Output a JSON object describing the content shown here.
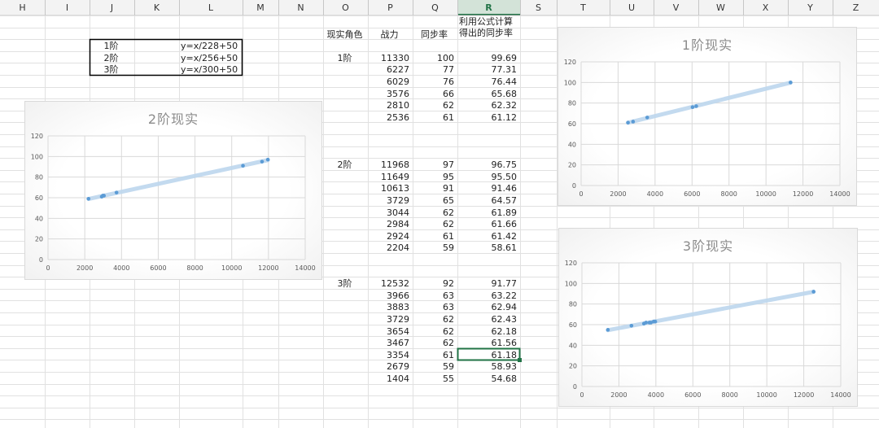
{
  "columns": [
    "H",
    "I",
    "J",
    "K",
    "L",
    "M",
    "N",
    "O",
    "P",
    "Q",
    "R",
    "S",
    "T",
    "U",
    "V",
    "W",
    "X",
    "Y",
    "Z"
  ],
  "active_column": "R",
  "formula_box": [
    {
      "level": "1阶",
      "formula": "y=x/228+50"
    },
    {
      "level": "2阶",
      "formula": "y=x/256+50"
    },
    {
      "level": "3阶",
      "formula": "y=x/300+50"
    }
  ],
  "table": {
    "headers": {
      "role": "现实角色",
      "power": "战力",
      "sync": "同步率",
      "calc": "利用公式计算得出的同步率"
    },
    "groups": [
      {
        "label": "1阶",
        "rows": [
          [
            "11330",
            "100",
            "99.69"
          ],
          [
            "6227",
            "77",
            "77.31"
          ],
          [
            "6029",
            "76",
            "76.44"
          ],
          [
            "3576",
            "66",
            "65.68"
          ],
          [
            "2810",
            "62",
            "62.32"
          ],
          [
            "2536",
            "61",
            "61.12"
          ]
        ]
      },
      {
        "label": "2阶",
        "rows": [
          [
            "11968",
            "97",
            "96.75"
          ],
          [
            "11649",
            "95",
            "95.50"
          ],
          [
            "10613",
            "91",
            "91.46"
          ],
          [
            "3729",
            "65",
            "64.57"
          ],
          [
            "3044",
            "62",
            "61.89"
          ],
          [
            "2984",
            "62",
            "61.66"
          ],
          [
            "2924",
            "61",
            "61.42"
          ],
          [
            "2204",
            "59",
            "58.61"
          ]
        ]
      },
      {
        "label": "3阶",
        "rows": [
          [
            "12532",
            "92",
            "91.77"
          ],
          [
            "3966",
            "63",
            "63.22"
          ],
          [
            "3883",
            "63",
            "62.94"
          ],
          [
            "3729",
            "62",
            "62.43"
          ],
          [
            "3654",
            "62",
            "62.18"
          ],
          [
            "3467",
            "62",
            "61.56"
          ],
          [
            "3354",
            "61",
            "61.18"
          ],
          [
            "2679",
            "59",
            "58.93"
          ],
          [
            "1404",
            "55",
            "54.68"
          ]
        ]
      }
    ]
  },
  "colors": {
    "marker": "#5b9bd5",
    "trendline": "#bdd7ee",
    "gridline": "#d9d9d9",
    "selection": "#217346"
  },
  "chart_data": [
    {
      "type": "scatter",
      "title": "1阶现实",
      "xlim": [
        0,
        14000
      ],
      "ylim": [
        0,
        120
      ],
      "xticks": [
        0,
        2000,
        4000,
        6000,
        8000,
        10000,
        12000,
        14000
      ],
      "yticks": [
        0,
        20,
        40,
        60,
        80,
        100,
        120
      ],
      "x": [
        11330,
        6227,
        6029,
        3576,
        2810,
        2536
      ],
      "y": [
        100,
        77,
        76,
        66,
        62,
        61
      ],
      "trendline": "linear",
      "grid": true
    },
    {
      "type": "scatter",
      "title": "2阶现实",
      "xlim": [
        0,
        14000
      ],
      "ylim": [
        0,
        120
      ],
      "xticks": [
        0,
        2000,
        4000,
        6000,
        8000,
        10000,
        12000,
        14000
      ],
      "yticks": [
        0,
        20,
        40,
        60,
        80,
        100,
        120
      ],
      "x": [
        11968,
        11649,
        10613,
        3729,
        3044,
        2984,
        2924,
        2204
      ],
      "y": [
        97,
        95,
        91,
        65,
        62,
        62,
        61,
        59
      ],
      "trendline": "linear",
      "grid": true
    },
    {
      "type": "scatter",
      "title": "3阶现实",
      "xlim": [
        0,
        14000
      ],
      "ylim": [
        0,
        120
      ],
      "xticks": [
        0,
        2000,
        4000,
        6000,
        8000,
        10000,
        12000,
        14000
      ],
      "yticks": [
        0,
        20,
        40,
        60,
        80,
        100,
        120
      ],
      "x": [
        12532,
        3966,
        3883,
        3729,
        3654,
        3467,
        3354,
        2679,
        1404
      ],
      "y": [
        92,
        63,
        63,
        62,
        62,
        62,
        61,
        59,
        55
      ],
      "trendline": "linear",
      "grid": true
    }
  ]
}
